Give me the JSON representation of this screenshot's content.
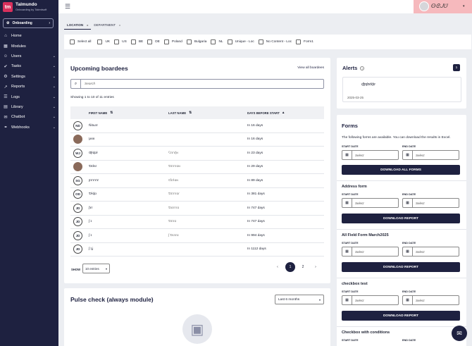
{
  "brand": {
    "name": "Talmundo",
    "tagline": "Onboarding by Talentsoft",
    "logo": "tm"
  },
  "env_selector": {
    "label": "Onboarding"
  },
  "sidebar": {
    "items": [
      {
        "label": "Home",
        "icon": "home-icon",
        "glyph": "⌂",
        "expandable": false
      },
      {
        "label": "Modules",
        "icon": "modules-icon",
        "glyph": "▦",
        "expandable": false
      },
      {
        "label": "Users",
        "icon": "users-icon",
        "glyph": "☺",
        "expandable": true
      },
      {
        "label": "Tasks",
        "icon": "tasks-icon",
        "glyph": "✔",
        "expandable": true
      },
      {
        "label": "Settings",
        "icon": "settings-icon",
        "glyph": "⚙",
        "expandable": true
      },
      {
        "label": "Reports",
        "icon": "reports-icon",
        "glyph": "↗",
        "expandable": true
      },
      {
        "label": "Logs",
        "icon": "logs-icon",
        "glyph": "☰",
        "expandable": true
      },
      {
        "label": "Library",
        "icon": "library-icon",
        "glyph": "▤",
        "expandable": true
      },
      {
        "label": "Chatbot",
        "icon": "chatbot-icon",
        "glyph": "✉",
        "expandable": true
      },
      {
        "label": "Webhooks",
        "icon": "webhooks-icon",
        "glyph": "⚭",
        "expandable": true
      }
    ]
  },
  "topbar": {
    "user_name": "ʘᘓᒍᕫ"
  },
  "tabs": [
    {
      "label": "LOCATION",
      "x": "x"
    },
    {
      "label": "DEPARTMENT",
      "x": "x"
    }
  ],
  "filters": [
    "Select all",
    "UK",
    "US",
    "BE",
    "DE",
    "Poland",
    "Bulgaria",
    "NL",
    "Unique - Loc",
    "No Content - Loc",
    "Form1"
  ],
  "boardees": {
    "title": "Upcoming boardees",
    "view_all": "View all boardees",
    "search_placeholder": "Search",
    "showing": "Showing 1 to 10 of 11 entries",
    "columns": {
      "first": "FIRST NAME",
      "last": "LAST NAME",
      "days": "DAYS BEFORE START"
    },
    "rows": [
      {
        "initials": "ND",
        "first": "Ñitɯɤ",
        "last": "",
        "days": "In 16 days"
      },
      {
        "initials": "",
        "first": "ʅɜɞɞ",
        "last": "",
        "days": "In 16 days"
      },
      {
        "initials": "WJ",
        "first": "Ƣɫɖɑɫ",
        "last": "ʕɪɤɤɭɴ",
        "days": "In 23 days"
      },
      {
        "initials": "",
        "first": "Ɗɪɫɞɾ",
        "last": "Ɗɪɤɤɑɴ",
        "days": "In 29 days"
      },
      {
        "initials": "SG",
        "first": "ʂɤɤɤɤ",
        "last": "Ɠɪɾɫɑɴ",
        "days": "In 89 days"
      },
      {
        "initials": "OD",
        "first": "Ɗɫɖɑ",
        "last": "Ɗɪɤɤɑɾ",
        "days": "In 381 days"
      },
      {
        "initials": "JD",
        "first": "ʃɤɾ",
        "last": "Ɗɑɤɤɑ",
        "days": "In 747 days"
      },
      {
        "initials": "JD",
        "first": "ʃ ɪ",
        "last": "Ɗɪɤɑ",
        "days": "In 747 days"
      },
      {
        "initials": "JD",
        "first": "ʃ ɪ",
        "last": "ʃ Ɗɑɤɑ",
        "days": "In 994 days"
      },
      {
        "initials": "JD",
        "first": "ʃ ɪʝ",
        "last": "",
        "days": "In 1112 days"
      }
    ],
    "show_label": "SHOW",
    "entries_select": "10 entries",
    "pages": [
      "1",
      "2"
    ],
    "active_page": "1"
  },
  "pulse": {
    "title": "Pulse check (always module)",
    "range": "Last 6 months"
  },
  "alerts": {
    "title": "Alerts",
    "count": "1",
    "item_name": "ɖɮɖɑɗɖɑ",
    "item_date": "2025-03-25"
  },
  "forms": {
    "title": "Forms",
    "description": "The following forms are available. You can download the results in Excel.",
    "start_label": "START DATE",
    "end_label": "END DATE",
    "select_placeholder": "Select",
    "download_all": "DOWNLOAD ALL FORMS",
    "download_report": "DOWNLOAD REPORT",
    "sections": [
      "Address form",
      "All Field Form March2025",
      "checkbox test",
      "Checkbox with conditions"
    ]
  },
  "colors": {
    "navy": "#1e2140",
    "brand": "#d9305c",
    "user_area": "#f6b9bd"
  }
}
